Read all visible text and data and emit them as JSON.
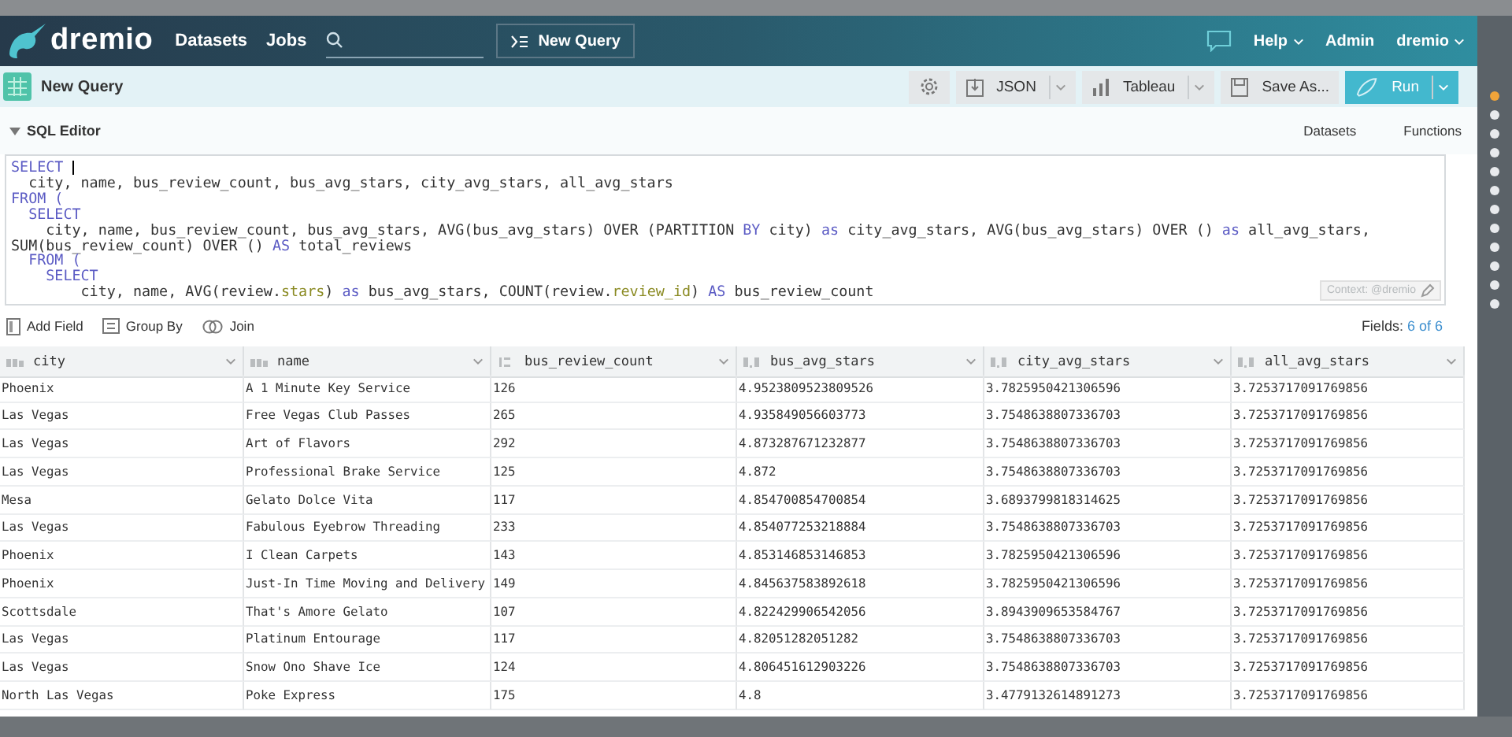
{
  "nav": {
    "brand": "dremio",
    "links": [
      "Datasets",
      "Jobs"
    ],
    "new_query": "New Query",
    "right": [
      {
        "label": "Help",
        "caret": true
      },
      {
        "label": "Admin",
        "caret": false
      },
      {
        "label": "dremio",
        "caret": true
      }
    ]
  },
  "query_bar": {
    "title": "New Query",
    "buttons": [
      {
        "kind": "settings"
      },
      {
        "kind": "export",
        "label": "JSON",
        "caret": true
      },
      {
        "kind": "chart",
        "label": "Tableau",
        "caret": true
      },
      {
        "kind": "save",
        "label": "Save As..."
      },
      {
        "kind": "run",
        "label": "Run",
        "caret": true
      }
    ]
  },
  "editor": {
    "title": "SQL Editor",
    "expanded": true,
    "tabs": [
      "Datasets",
      "Functions"
    ],
    "context": "Context: @dremio",
    "lines": [
      [
        {
          "text": "SELECT ",
          "kind": "keyword"
        }
      ],
      [
        {
          "text": "  city, name, bus_review_count, bus_avg_stars, city_avg_stars, all_avg_stars",
          "kind": "plain"
        }
      ],
      [
        {
          "text": "FROM (",
          "kind": "keyword"
        }
      ],
      [
        {
          "text": "  SELECT",
          "kind": "keyword"
        }
      ],
      [
        {
          "text": "    city, name, bus_review_count, bus_avg_stars, AVG(bus_avg_stars) OVER (PARTITION ",
          "kind": "plain"
        },
        {
          "text": "BY",
          "kind": "keyword"
        },
        {
          "text": " city) ",
          "kind": "plain"
        },
        {
          "text": "as",
          "kind": "keyword"
        },
        {
          "text": " city_avg_stars, AVG(bus_avg_stars) OVER () ",
          "kind": "plain"
        },
        {
          "text": "as",
          "kind": "keyword"
        },
        {
          "text": " all_avg_stars,",
          "kind": "plain"
        }
      ],
      [
        {
          "text": "SUM(bus_review_count) OVER () ",
          "kind": "plain"
        },
        {
          "text": "AS",
          "kind": "keyword"
        },
        {
          "text": " total_reviews",
          "kind": "plain"
        }
      ],
      [
        {
          "text": "  FROM (",
          "kind": "keyword"
        }
      ],
      [
        {
          "text": "    SELECT",
          "kind": "keyword"
        }
      ],
      [
        {
          "text": "        city, name, AVG(review.",
          "kind": "plain"
        },
        {
          "text": "stars",
          "kind": "field"
        },
        {
          "text": ") ",
          "kind": "plain"
        },
        {
          "text": "as",
          "kind": "keyword"
        },
        {
          "text": " bus_avg_stars, COUNT(review.",
          "kind": "plain"
        },
        {
          "text": "review_id",
          "kind": "field"
        },
        {
          "text": ") ",
          "kind": "plain"
        },
        {
          "text": "AS",
          "kind": "keyword"
        },
        {
          "text": " bus_review_count",
          "kind": "plain"
        }
      ]
    ]
  },
  "actions": [
    {
      "kind": "add",
      "label": "Add Field"
    },
    {
      "kind": "group",
      "label": "Group By"
    },
    {
      "kind": "join",
      "label": "Join"
    }
  ],
  "fields": {
    "label": "Fields:",
    "count": "6 of 6"
  },
  "table": {
    "columns": [
      {
        "name": "city",
        "kind": "text"
      },
      {
        "name": "name",
        "kind": "text"
      },
      {
        "name": "bus_review_count",
        "kind": "integer"
      },
      {
        "name": "bus_avg_stars",
        "kind": "decimal"
      },
      {
        "name": "city_avg_stars",
        "kind": "decimal"
      },
      {
        "name": "all_avg_stars",
        "kind": "decimal"
      }
    ],
    "rows": [
      [
        "Phoenix",
        "A 1 Minute Key Service",
        "126",
        "4.9523809523809526",
        "3.7825950421306596",
        "3.7253717091769856"
      ],
      [
        "Las Vegas",
        "Free Vegas Club Passes",
        "265",
        "4.935849056603773",
        "3.7548638807336703",
        "3.7253717091769856"
      ],
      [
        "Las Vegas",
        "Art of Flavors",
        "292",
        "4.873287671232877",
        "3.7548638807336703",
        "3.7253717091769856"
      ],
      [
        "Las Vegas",
        "Professional Brake Service",
        "125",
        "4.872",
        "3.7548638807336703",
        "3.7253717091769856"
      ],
      [
        "Mesa",
        "Gelato Dolce Vita",
        "117",
        "4.854700854700854",
        "3.6893799818314625",
        "3.7253717091769856"
      ],
      [
        "Las Vegas",
        "Fabulous Eyebrow Threading",
        "233",
        "4.854077253218884",
        "3.7548638807336703",
        "3.7253717091769856"
      ],
      [
        "Phoenix",
        "I Clean Carpets",
        "143",
        "4.853146853146853",
        "3.7825950421306596",
        "3.7253717091769856"
      ],
      [
        "Phoenix",
        "Just-In Time Moving and Delivery",
        "149",
        "4.845637583892618",
        "3.7825950421306596",
        "3.7253717091769856"
      ],
      [
        "Scottsdale",
        "That's Amore Gelato",
        "107",
        "4.822429906542056",
        "3.8943909653584767",
        "3.7253717091769856"
      ],
      [
        "Las Vegas",
        "Platinum Entourage",
        "117",
        "4.82051282051282",
        "3.7548638807336703",
        "3.7253717091769856"
      ],
      [
        "Las Vegas",
        "Snow Ono Shave Ice",
        "124",
        "4.806451612903226",
        "3.7548638807336703",
        "3.7253717091769856"
      ],
      [
        "North Las Vegas",
        "Poke Express",
        "175",
        "4.8",
        "3.4779132614891273",
        "3.7253717091769856"
      ]
    ]
  },
  "side_dots": [
    {
      "selected": true
    },
    {
      "selected": false
    },
    {
      "selected": false
    },
    {
      "selected": false
    },
    {
      "selected": false
    },
    {
      "selected": false
    },
    {
      "selected": false
    },
    {
      "selected": false
    },
    {
      "selected": false
    },
    {
      "selected": false
    },
    {
      "selected": false
    },
    {
      "selected": false
    }
  ]
}
